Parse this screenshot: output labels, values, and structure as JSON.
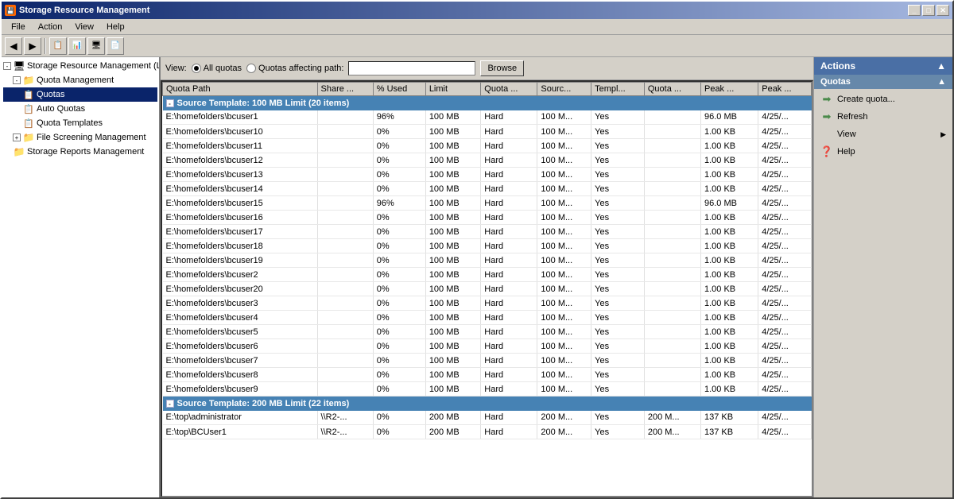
{
  "window": {
    "title": "Storage Resource Management",
    "icon": "💾",
    "buttons": [
      "_",
      "□",
      "✕"
    ]
  },
  "menu": {
    "items": [
      "File",
      "Action",
      "View",
      "Help"
    ]
  },
  "toolbar": {
    "buttons": [
      "◀",
      "▶",
      "📋",
      "📊",
      "🖥",
      "📄"
    ]
  },
  "viewBar": {
    "label": "View:",
    "options": [
      {
        "id": "all",
        "label": "All quotas",
        "selected": true
      },
      {
        "id": "path",
        "label": "Quotas affecting path:",
        "selected": false
      }
    ],
    "pathPlaceholder": "",
    "browseLabel": "Browse"
  },
  "tree": {
    "items": [
      {
        "id": "root",
        "label": "Storage Resource Management (Lo",
        "indent": 0,
        "expanded": true,
        "icon": "🖥",
        "hasExpander": true
      },
      {
        "id": "quota-mgmt",
        "label": "Quota Management",
        "indent": 1,
        "expanded": true,
        "icon": "📁",
        "hasExpander": true
      },
      {
        "id": "quotas",
        "label": "Quotas",
        "indent": 2,
        "expanded": false,
        "icon": "📋",
        "hasExpander": false,
        "selected": true
      },
      {
        "id": "auto-quotas",
        "label": "Auto Quotas",
        "indent": 2,
        "expanded": false,
        "icon": "📋",
        "hasExpander": false
      },
      {
        "id": "quota-templates",
        "label": "Quota Templates",
        "indent": 2,
        "expanded": false,
        "icon": "📋",
        "hasExpander": false
      },
      {
        "id": "file-screening",
        "label": "File Screening Management",
        "indent": 1,
        "expanded": false,
        "icon": "📁",
        "hasExpander": true
      },
      {
        "id": "storage-reports",
        "label": "Storage Reports Management",
        "indent": 1,
        "expanded": false,
        "icon": "📁",
        "hasExpander": false
      }
    ]
  },
  "table": {
    "columns": [
      {
        "id": "quotaPath",
        "label": "Quota Path",
        "width": 145
      },
      {
        "id": "shareName",
        "label": "Share ...",
        "width": 55
      },
      {
        "id": "pctUsed",
        "label": "% Used",
        "width": 45
      },
      {
        "id": "limit",
        "label": "Limit",
        "width": 52
      },
      {
        "id": "quotaType",
        "label": "Quota ...",
        "width": 50
      },
      {
        "id": "sourceTemplate",
        "label": "Sourc...",
        "width": 50
      },
      {
        "id": "templateMatch",
        "label": "Templ...",
        "width": 50
      },
      {
        "id": "quotaStatus",
        "label": "Quota ...",
        "width": 50
      },
      {
        "id": "peakUsage",
        "label": "Peak ...",
        "width": 55
      },
      {
        "id": "peakDate",
        "label": "Peak ...",
        "width": 50
      }
    ],
    "groups": [
      {
        "header": "Source Template: 100 MB Limit (20 items)",
        "rows": [
          {
            "quotaPath": "E:\\homefolders\\bcuser1",
            "shareName": "",
            "pctUsed": "96%",
            "limit": "100 MB",
            "quotaType": "Hard",
            "sourceTemplate": "100 M...",
            "templateMatch": "Yes",
            "quotaStatus": "",
            "peakUsage": "96.0 MB",
            "peakDate": "4/25/..."
          },
          {
            "quotaPath": "E:\\homefolders\\bcuser10",
            "shareName": "",
            "pctUsed": "0%",
            "limit": "100 MB",
            "quotaType": "Hard",
            "sourceTemplate": "100 M...",
            "templateMatch": "Yes",
            "quotaStatus": "",
            "peakUsage": "1.00 KB",
            "peakDate": "4/25/..."
          },
          {
            "quotaPath": "E:\\homefolders\\bcuser11",
            "shareName": "",
            "pctUsed": "0%",
            "limit": "100 MB",
            "quotaType": "Hard",
            "sourceTemplate": "100 M...",
            "templateMatch": "Yes",
            "quotaStatus": "",
            "peakUsage": "1.00 KB",
            "peakDate": "4/25/..."
          },
          {
            "quotaPath": "E:\\homefolders\\bcuser12",
            "shareName": "",
            "pctUsed": "0%",
            "limit": "100 MB",
            "quotaType": "Hard",
            "sourceTemplate": "100 M...",
            "templateMatch": "Yes",
            "quotaStatus": "",
            "peakUsage": "1.00 KB",
            "peakDate": "4/25/..."
          },
          {
            "quotaPath": "E:\\homefolders\\bcuser13",
            "shareName": "",
            "pctUsed": "0%",
            "limit": "100 MB",
            "quotaType": "Hard",
            "sourceTemplate": "100 M...",
            "templateMatch": "Yes",
            "quotaStatus": "",
            "peakUsage": "1.00 KB",
            "peakDate": "4/25/..."
          },
          {
            "quotaPath": "E:\\homefolders\\bcuser14",
            "shareName": "",
            "pctUsed": "0%",
            "limit": "100 MB",
            "quotaType": "Hard",
            "sourceTemplate": "100 M...",
            "templateMatch": "Yes",
            "quotaStatus": "",
            "peakUsage": "1.00 KB",
            "peakDate": "4/25/..."
          },
          {
            "quotaPath": "E:\\homefolders\\bcuser15",
            "shareName": "",
            "pctUsed": "96%",
            "limit": "100 MB",
            "quotaType": "Hard",
            "sourceTemplate": "100 M...",
            "templateMatch": "Yes",
            "quotaStatus": "",
            "peakUsage": "96.0 MB",
            "peakDate": "4/25/..."
          },
          {
            "quotaPath": "E:\\homefolders\\bcuser16",
            "shareName": "",
            "pctUsed": "0%",
            "limit": "100 MB",
            "quotaType": "Hard",
            "sourceTemplate": "100 M...",
            "templateMatch": "Yes",
            "quotaStatus": "",
            "peakUsage": "1.00 KB",
            "peakDate": "4/25/..."
          },
          {
            "quotaPath": "E:\\homefolders\\bcuser17",
            "shareName": "",
            "pctUsed": "0%",
            "limit": "100 MB",
            "quotaType": "Hard",
            "sourceTemplate": "100 M...",
            "templateMatch": "Yes",
            "quotaStatus": "",
            "peakUsage": "1.00 KB",
            "peakDate": "4/25/..."
          },
          {
            "quotaPath": "E:\\homefolders\\bcuser18",
            "shareName": "",
            "pctUsed": "0%",
            "limit": "100 MB",
            "quotaType": "Hard",
            "sourceTemplate": "100 M...",
            "templateMatch": "Yes",
            "quotaStatus": "",
            "peakUsage": "1.00 KB",
            "peakDate": "4/25/..."
          },
          {
            "quotaPath": "E:\\homefolders\\bcuser19",
            "shareName": "",
            "pctUsed": "0%",
            "limit": "100 MB",
            "quotaType": "Hard",
            "sourceTemplate": "100 M...",
            "templateMatch": "Yes",
            "quotaStatus": "",
            "peakUsage": "1.00 KB",
            "peakDate": "4/25/..."
          },
          {
            "quotaPath": "E:\\homefolders\\bcuser2",
            "shareName": "",
            "pctUsed": "0%",
            "limit": "100 MB",
            "quotaType": "Hard",
            "sourceTemplate": "100 M...",
            "templateMatch": "Yes",
            "quotaStatus": "",
            "peakUsage": "1.00 KB",
            "peakDate": "4/25/..."
          },
          {
            "quotaPath": "E:\\homefolders\\bcuser20",
            "shareName": "",
            "pctUsed": "0%",
            "limit": "100 MB",
            "quotaType": "Hard",
            "sourceTemplate": "100 M...",
            "templateMatch": "Yes",
            "quotaStatus": "",
            "peakUsage": "1.00 KB",
            "peakDate": "4/25/..."
          },
          {
            "quotaPath": "E:\\homefolders\\bcuser3",
            "shareName": "",
            "pctUsed": "0%",
            "limit": "100 MB",
            "quotaType": "Hard",
            "sourceTemplate": "100 M...",
            "templateMatch": "Yes",
            "quotaStatus": "",
            "peakUsage": "1.00 KB",
            "peakDate": "4/25/..."
          },
          {
            "quotaPath": "E:\\homefolders\\bcuser4",
            "shareName": "",
            "pctUsed": "0%",
            "limit": "100 MB",
            "quotaType": "Hard",
            "sourceTemplate": "100 M...",
            "templateMatch": "Yes",
            "quotaStatus": "",
            "peakUsage": "1.00 KB",
            "peakDate": "4/25/..."
          },
          {
            "quotaPath": "E:\\homefolders\\bcuser5",
            "shareName": "",
            "pctUsed": "0%",
            "limit": "100 MB",
            "quotaType": "Hard",
            "sourceTemplate": "100 M...",
            "templateMatch": "Yes",
            "quotaStatus": "",
            "peakUsage": "1.00 KB",
            "peakDate": "4/25/..."
          },
          {
            "quotaPath": "E:\\homefolders\\bcuser6",
            "shareName": "",
            "pctUsed": "0%",
            "limit": "100 MB",
            "quotaType": "Hard",
            "sourceTemplate": "100 M...",
            "templateMatch": "Yes",
            "quotaStatus": "",
            "peakUsage": "1.00 KB",
            "peakDate": "4/25/..."
          },
          {
            "quotaPath": "E:\\homefolders\\bcuser7",
            "shareName": "",
            "pctUsed": "0%",
            "limit": "100 MB",
            "quotaType": "Hard",
            "sourceTemplate": "100 M...",
            "templateMatch": "Yes",
            "quotaStatus": "",
            "peakUsage": "1.00 KB",
            "peakDate": "4/25/..."
          },
          {
            "quotaPath": "E:\\homefolders\\bcuser8",
            "shareName": "",
            "pctUsed": "0%",
            "limit": "100 MB",
            "quotaType": "Hard",
            "sourceTemplate": "100 M...",
            "templateMatch": "Yes",
            "quotaStatus": "",
            "peakUsage": "1.00 KB",
            "peakDate": "4/25/..."
          },
          {
            "quotaPath": "E:\\homefolders\\bcuser9",
            "shareName": "",
            "pctUsed": "0%",
            "limit": "100 MB",
            "quotaType": "Hard",
            "sourceTemplate": "100 M...",
            "templateMatch": "Yes",
            "quotaStatus": "",
            "peakUsage": "1.00 KB",
            "peakDate": "4/25/..."
          }
        ]
      },
      {
        "header": "Source Template: 200 MB Limit (22 items)",
        "rows": [
          {
            "quotaPath": "E:\\top\\administrator",
            "shareName": "\\\\R2-...",
            "pctUsed": "0%",
            "limit": "200 MB",
            "quotaType": "Hard",
            "sourceTemplate": "200 M...",
            "templateMatch": "Yes",
            "quotaStatus": "200 M...",
            "peakUsage": "137 KB",
            "peakDate": "4/25/..."
          },
          {
            "quotaPath": "E:\\top\\BCUser1",
            "shareName": "\\\\R2-...",
            "pctUsed": "0%",
            "limit": "200 MB",
            "quotaType": "Hard",
            "sourceTemplate": "200 M...",
            "templateMatch": "Yes",
            "quotaStatus": "200 M...",
            "peakUsage": "137 KB",
            "peakDate": "4/25/..."
          }
        ]
      }
    ]
  },
  "actions": {
    "panelTitle": "Actions",
    "sections": [
      {
        "title": "Quotas",
        "items": [
          {
            "id": "create-quota",
            "label": "Create quota...",
            "icon": "➡"
          },
          {
            "id": "refresh",
            "label": "Refresh",
            "icon": "➡"
          },
          {
            "id": "view",
            "label": "View",
            "icon": "",
            "hasArrow": true
          },
          {
            "id": "help",
            "label": "Help",
            "icon": "❓"
          }
        ]
      }
    ]
  },
  "colors": {
    "titleBarStart": "#0a246a",
    "titleBarEnd": "#a6b8e0",
    "groupHeader": "#4682b4",
    "actionsHeader": "#4a6fa5",
    "actionsSectionHeader": "#6688aa",
    "selectedBg": "#0a246a"
  }
}
